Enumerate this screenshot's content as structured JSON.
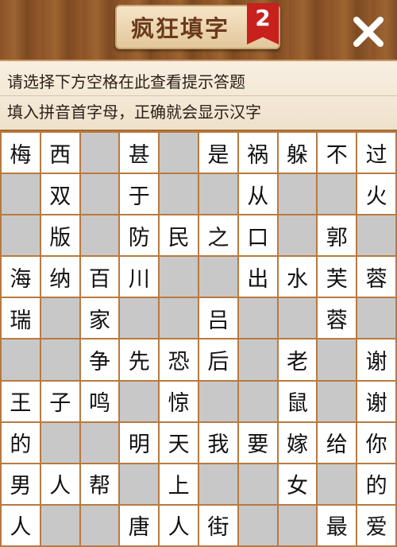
{
  "header": {
    "title": "疯狂填字",
    "level": "2"
  },
  "hint": {
    "line1": "请选择下方空格在此查看提示答题",
    "line2": "填入拼音首字母，正确就会显示汉字"
  },
  "colors": {
    "wood": "#8a5428",
    "blank_cell": "#c8c8c8",
    "filled_cell": "#ffffff",
    "badge": "#c8201c",
    "grid_line": "#b87a40"
  },
  "grid": [
    [
      "梅",
      "西",
      "",
      "甚",
      "",
      "是",
      "祸",
      "躲",
      "不",
      "过"
    ],
    [
      "",
      "双",
      "",
      "于",
      "",
      "",
      "从",
      "",
      "",
      "火"
    ],
    [
      "",
      "版",
      "",
      "防",
      "民",
      "之",
      "口",
      "",
      "郭",
      ""
    ],
    [
      "海",
      "纳",
      "百",
      "川",
      "",
      "",
      "出",
      "水",
      "芙",
      "蓉"
    ],
    [
      "瑞",
      "",
      "家",
      "",
      "",
      "吕",
      "",
      "",
      "蓉",
      ""
    ],
    [
      "",
      "",
      "争",
      "先",
      "恐",
      "后",
      "",
      "老",
      "",
      "谢"
    ],
    [
      "王",
      "子",
      "鸣",
      "",
      "惊",
      "",
      "",
      "鼠",
      "",
      "谢"
    ],
    [
      "的",
      "",
      "",
      "明",
      "天",
      "我",
      "要",
      "嫁",
      "给",
      "你"
    ],
    [
      "男",
      "人",
      "帮",
      "",
      "上",
      "",
      "",
      "女",
      "",
      "的"
    ],
    [
      "人",
      "",
      "",
      "唐",
      "人",
      "街",
      "",
      "",
      "最",
      "爱"
    ]
  ]
}
